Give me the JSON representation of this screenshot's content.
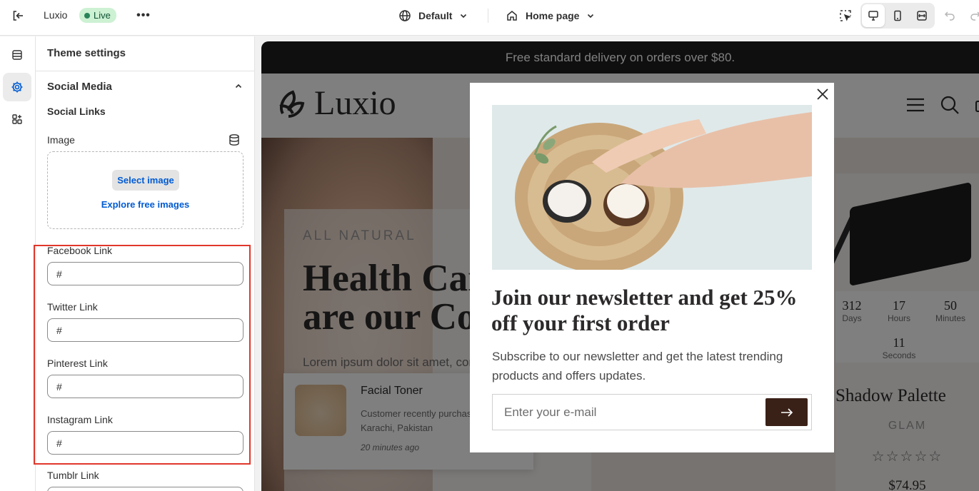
{
  "topbar": {
    "store_name": "Luxio",
    "status": "Live",
    "theme_name": "Default",
    "page_name": "Home page"
  },
  "panel": {
    "title": "Theme settings",
    "section": "Social Media",
    "subsection": "Social Links",
    "image": {
      "label": "Image",
      "select_label": "Select image",
      "explore_label": "Explore free images"
    },
    "fields": [
      {
        "label": "Facebook Link",
        "value": "#"
      },
      {
        "label": "Twitter Link",
        "value": "#"
      },
      {
        "label": "Pinterest Link",
        "value": "#"
      },
      {
        "label": "Instagram Link",
        "value": "#"
      },
      {
        "label": "Tumblr Link",
        "value": ""
      }
    ]
  },
  "preview": {
    "announcement": "Free standard delivery on orders over $80.",
    "logo_text": "Luxio",
    "hero": {
      "eyebrow": "ALL NATURAL",
      "heading": "Health Car\nare our Co",
      "text": "Lorem ipsum dolor sit amet, cons"
    },
    "toast": {
      "title": "Facial Toner",
      "description": "Customer recently purchas\nKarachi, Pakistan",
      "time": "20 minutes ago"
    },
    "product": {
      "timer": {
        "days": "312",
        "days_label": "Days",
        "hours": "17",
        "hours_label": "Hours",
        "minutes": "50",
        "minutes_label": "Minutes",
        "seconds": "11",
        "seconds_label": "Seconds"
      },
      "title": "Shadow Palette",
      "brand": "GLAM",
      "stars": "☆☆☆☆☆",
      "price": "$74.95"
    },
    "modal": {
      "title": "Join our newsletter and get 25% off your first order",
      "description": "Subscribe to our newsletter and get the latest trending products and offers updates.",
      "email_placeholder": "Enter your e-mail"
    }
  },
  "colors": {
    "highlight": "#e0372b",
    "live_badge": "#cdf1d3",
    "link_blue": "#005bd3",
    "submit_button": "#3a2117"
  }
}
